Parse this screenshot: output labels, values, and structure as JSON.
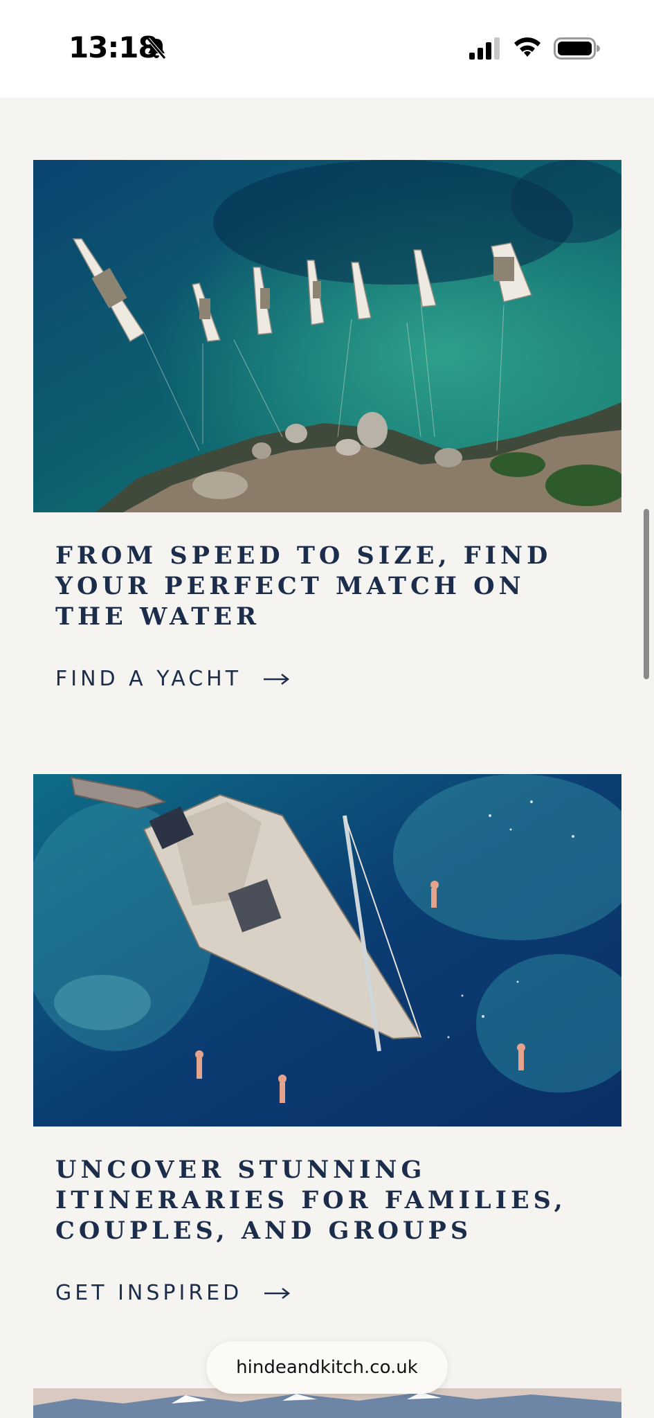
{
  "status_bar": {
    "time": "13:18",
    "icons": [
      "bell-slash-icon",
      "cellular-signal-icon",
      "wifi-icon",
      "battery-icon"
    ]
  },
  "cards": [
    {
      "image": "aerial-boats-anchored-rocky-coast",
      "headline": "FROM SPEED TO SIZE, FIND YOUR PERFECT MATCH ON THE WATER",
      "cta_label": "FIND A YACHT",
      "cta_icon": "arrow-right-icon"
    },
    {
      "image": "aerial-sailboat-swimmers",
      "headline": "UNCOVER STUNNING ITINERARIES FOR FAMILIES, COUPLES, AND GROUPS",
      "cta_label": "GET INSPIRED",
      "cta_icon": "arrow-right-icon"
    }
  ],
  "browser": {
    "url": "hindeandkitch.co.uk"
  },
  "colors": {
    "page_background": "#f5f4f1",
    "text_navy": "#1b2d4b"
  }
}
